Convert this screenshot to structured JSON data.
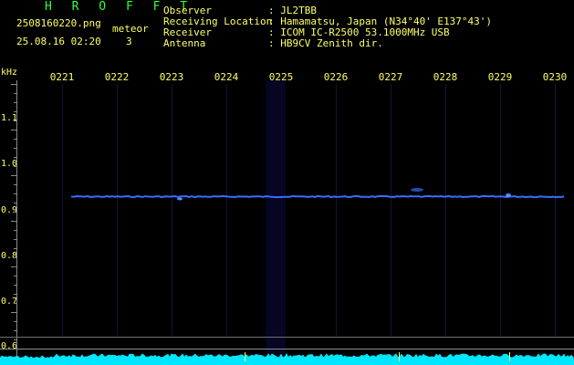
{
  "header": {
    "title": "H R O F F T",
    "filename": "2508160220.png",
    "datetime": "25.08.16 02:20",
    "meteor_label": "meteor",
    "meteor_count": "3",
    "info": [
      {
        "key": "Observer",
        "value": ": JL2TBB"
      },
      {
        "key": "Receiving Location",
        "value": ": Hamamatsu, Japan (N34°40' E137°43')"
      },
      {
        "key": "Receiver",
        "value": ": ICOM IC-R2500 53.1000MHz USB"
      },
      {
        "key": "Antenna",
        "value": ": HB9CV Zenith dir."
      }
    ]
  },
  "axis": {
    "unit": "kHz",
    "time_ticks": [
      "0221",
      "0222",
      "0223",
      "0224",
      "0225",
      "0226",
      "0227",
      "0228",
      "0229",
      "0230"
    ],
    "freq_ticks": [
      "1.1",
      "1.0",
      "0.9",
      "0.8",
      "0.7",
      "0.6"
    ]
  },
  "colors": {
    "background": "#000000",
    "text": "#ffff66",
    "title": "#33ff33",
    "grid": "#1c1c4a",
    "signal": "#3a6cff",
    "noise": "#00e6ff"
  },
  "chart_data": {
    "type": "heatmap",
    "xlabel": "",
    "ylabel": "kHz",
    "x_ticks": [
      "0221",
      "0222",
      "0223",
      "0224",
      "0225",
      "0226",
      "0227",
      "0228",
      "0229",
      "0230"
    ],
    "y_ticks": [
      1.1,
      1.0,
      0.9,
      0.8,
      0.7,
      0.6
    ],
    "ylim": [
      0.58,
      1.15
    ],
    "meteor_count": 3,
    "carrier_khz": 0.925
  }
}
